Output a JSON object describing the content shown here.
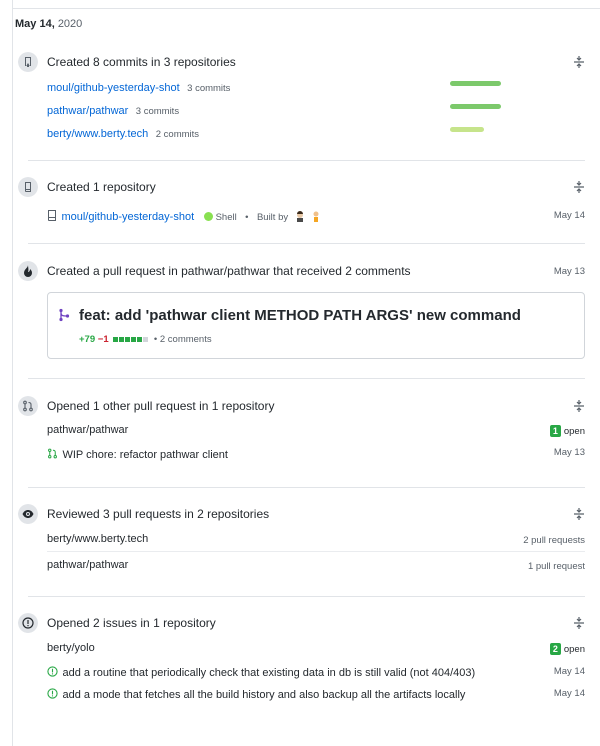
{
  "date": {
    "month_day": "May 14,",
    "year": "2020"
  },
  "colors": {
    "link": "#0366d6",
    "green": "#28a745",
    "red": "#cb2431",
    "bar_dark": "#7cc96b",
    "bar_light": "#c6e48b"
  },
  "commits": {
    "icon": "repo-push-icon",
    "title": "Created 8 commits in 3 repositories",
    "repos": [
      {
        "name": "moul/github-yesterday-shot",
        "count": "3 commits",
        "share": 0.375
      },
      {
        "name": "pathwar/pathwar",
        "count": "3 commits",
        "share": 0.375
      },
      {
        "name": "berty/www.berty.tech",
        "count": "2 commits",
        "share": 0.25
      }
    ]
  },
  "created_repo": {
    "icon": "repo-icon",
    "title": "Created 1 repository",
    "repo": "moul/github-yesterday-shot",
    "language": "Shell",
    "separator": "•",
    "built_by": "Built by",
    "date": "May 14"
  },
  "pull_request": {
    "icon": "flame-icon",
    "title_prefix": "Created a pull request in",
    "repo": "pathwar/pathwar",
    "title_suffix": "that received 2 comments",
    "date": "May 13",
    "pr_title": "feat: add 'pathwar client METHOD PATH ARGS' new command",
    "additions": "+79",
    "deletions": "−1",
    "comments": "2 comments",
    "diff_blocks": [
      "add",
      "add",
      "add",
      "add",
      "add",
      "neutral"
    ]
  },
  "opened_pr": {
    "icon": "git-pull-request-icon",
    "title": "Opened 1 other pull request in 1 repository",
    "repo": "pathwar/pathwar",
    "open_count": "1",
    "open_label": "open",
    "item_title": "WIP chore: refactor pathwar client",
    "date": "May 13"
  },
  "reviewed": {
    "icon": "eye-icon",
    "title": "Reviewed 3 pull requests in 2 repositories",
    "repos": [
      {
        "name": "berty/www.berty.tech",
        "count": "2 pull requests"
      },
      {
        "name": "pathwar/pathwar",
        "count": "1 pull request"
      }
    ]
  },
  "issues": {
    "icon": "issue-opened-icon",
    "title": "Opened 2 issues in 1 repository",
    "repo": "berty/yolo",
    "open_count": "2",
    "open_label": "open",
    "items": [
      {
        "title": "add a routine that periodically check that existing data in db is still valid (not 404/403)",
        "date": "May 14"
      },
      {
        "title": "add a mode that fetches all the build history and also backup all the artifacts locally",
        "date": "May 14"
      }
    ]
  }
}
